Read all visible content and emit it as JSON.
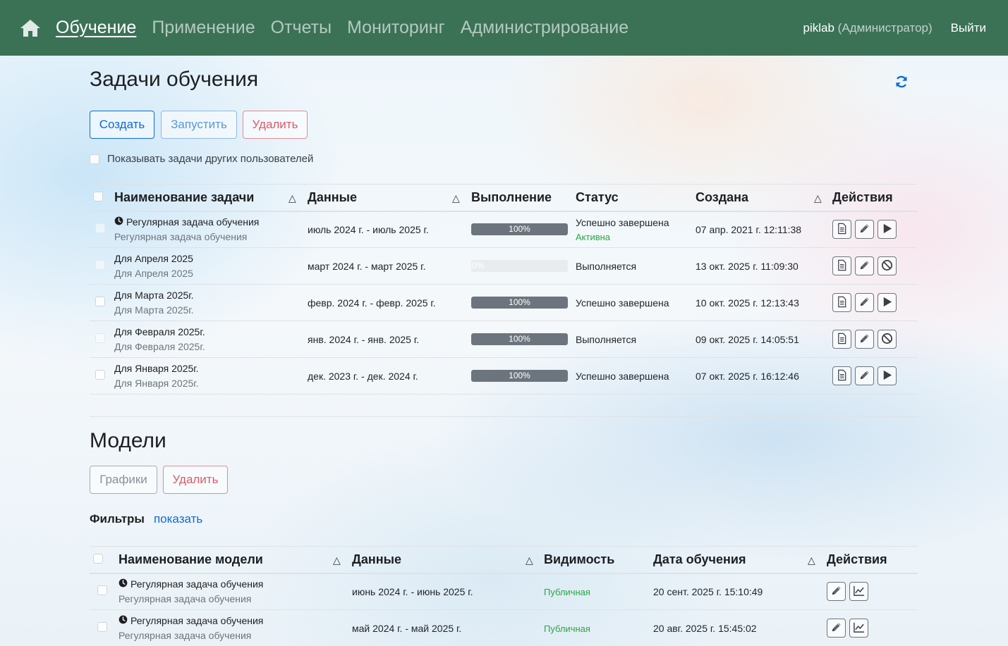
{
  "nav": {
    "items": [
      {
        "label": "Обучение",
        "active": true
      },
      {
        "label": "Применение",
        "active": false
      },
      {
        "label": "Отчеты",
        "active": false
      },
      {
        "label": "Мониторинг",
        "active": false
      },
      {
        "label": "Администрирование",
        "active": false
      }
    ],
    "user_name": "piklab",
    "user_role": "(Администратор)",
    "logout_label": "Выйти",
    "home_icon": "home-icon"
  },
  "tasks": {
    "title": "Задачи обучения",
    "refresh_icon": "refresh-icon",
    "buttons": {
      "create": "Создать",
      "run": "Запустить",
      "delete": "Удалить"
    },
    "show_others_label": "Показывать задачи других пользователей",
    "columns": [
      "Наименование задачи",
      "Данные",
      "Выполнение",
      "Статус",
      "Создана",
      "Действия"
    ],
    "sort_glyph": "△",
    "rows": [
      {
        "name": "Регулярная задача обучения",
        "sub": "Регулярная задача обучения",
        "scheduled": true,
        "data": "июль 2024 г. - июль 2025 г.",
        "progress": 100,
        "progress_label": "100%",
        "status": "Успешно завершена",
        "status_sub": "Активна",
        "created": "07 апр. 2021 г. 12:11:38",
        "run_action": "play"
      },
      {
        "name": "Для Апреля 2025",
        "sub": "Для Апреля 2025",
        "scheduled": false,
        "data": "март 2024 г. - март 2025 г.",
        "progress": 0,
        "progress_label": "0%",
        "status": "Выполняется",
        "status_sub": "",
        "created": "13 окт. 2025 г. 11:09:30",
        "run_action": "stop"
      },
      {
        "name": "Для Марта 2025г.",
        "sub": "Для Марта 2025г.",
        "scheduled": false,
        "data": "февр. 2024 г. - февр. 2025 г.",
        "progress": 100,
        "progress_label": "100%",
        "status": "Успешно завершена",
        "status_sub": "",
        "created": "10 окт. 2025 г. 12:13:43",
        "run_action": "play"
      },
      {
        "name": "Для Февраля 2025г.",
        "sub": "Для Февраля 2025г.",
        "scheduled": false,
        "data": "янв. 2024 г. - янв. 2025 г.",
        "progress": 100,
        "progress_label": "100%",
        "status": "Выполняется",
        "status_sub": "",
        "created": "09 окт. 2025 г. 14:05:51",
        "run_action": "stop"
      },
      {
        "name": "Для Января 2025г.",
        "sub": "Для Января 2025г.",
        "scheduled": false,
        "data": "дек. 2023 г. - дек. 2024 г.",
        "progress": 100,
        "progress_label": "100%",
        "status": "Успешно завершена",
        "status_sub": "",
        "created": "07 окт. 2025 г. 16:12:46",
        "run_action": "play"
      }
    ]
  },
  "models": {
    "title": "Модели",
    "buttons": {
      "charts": "Графики",
      "delete": "Удалить"
    },
    "filters_label": "Фильтры",
    "filters_toggle": "показать",
    "columns": [
      "Наименование модели",
      "Данные",
      "Видимость",
      "Дата обучения",
      "Действия"
    ],
    "rows": [
      {
        "name": "Регулярная задача обучения",
        "sub": "Регулярная задача обучения",
        "data": "июнь 2024 г. - июнь 2025 г.",
        "visibility": "Публичная",
        "trained": "20 сент. 2025 г. 15:10:49"
      },
      {
        "name": "Регулярная задача обучения",
        "sub": "Регулярная задача обучения",
        "data": "май 2024 г. - май 2025 г.",
        "visibility": "Публичная",
        "trained": "20 авг. 2025 г. 15:45:02"
      }
    ]
  },
  "colors": {
    "navbar": "#3b7256",
    "primary": "#0b6bd6",
    "danger": "#dc3545",
    "success": "#28a745",
    "progress": "#6c757d"
  }
}
